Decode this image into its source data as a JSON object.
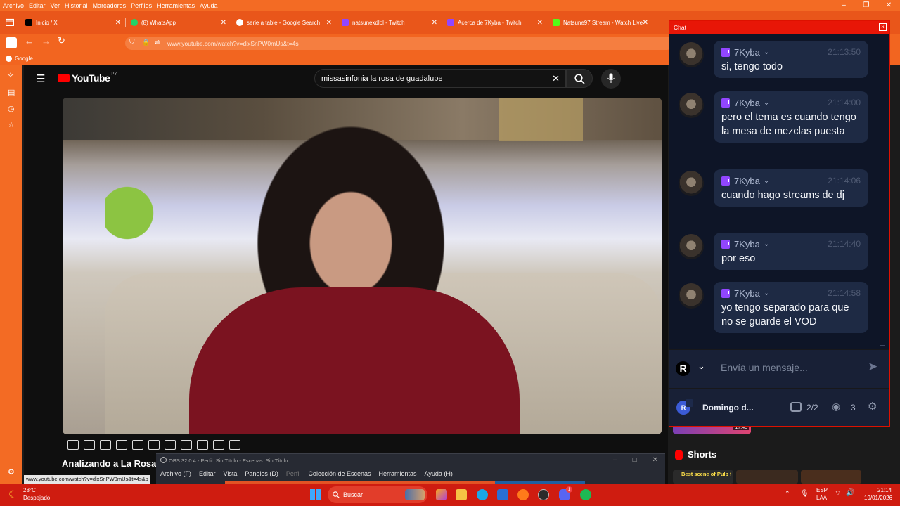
{
  "browser": {
    "menu": [
      "Archivo",
      "Editar",
      "Ver",
      "Historial",
      "Marcadores",
      "Perfiles",
      "Herramientas",
      "Ayuda"
    ],
    "tabs": [
      {
        "label": "Inicio / X",
        "color": "#000000"
      },
      {
        "label": "(8) WhatsApp",
        "color": "#25d366"
      },
      {
        "label": "serie a table - Google Search",
        "color": "#ffffff"
      },
      {
        "label": "natsunexdlol - Twitch",
        "color": "#9146ff"
      },
      {
        "label": "Acerca de 7Kyba - Twitch",
        "color": "#9146ff"
      },
      {
        "label": "Natsune97 Stream - Watch Live",
        "color": "#53fc18"
      }
    ],
    "url": "www.youtube.com/watch?v=dixSnPW0mUs&t=4s",
    "bookmark": "Google"
  },
  "youtube": {
    "logo_text": "YouTube",
    "region": "PY",
    "search_value": "missasinfonia la rosa de guadalupe",
    "video_title": "Analizando a La Rosa d",
    "status_url": "www.youtube.com/watch?v=dixSnPW0mUs&t=4s&p",
    "shorts_label": "Shorts",
    "short_caption": "Best scene of Pulp fiction",
    "thumb_duration": "17:45"
  },
  "obs": {
    "title": "OBS 32.0.4 - Perfil: Sin Título - Escenas: Sin Título",
    "menu": [
      "Archivo (F)",
      "Editar",
      "Vista",
      "Paneles (D)",
      "Perfil",
      "Colección de Escenas",
      "Herramientas",
      "Ayuda (H)"
    ]
  },
  "chat": {
    "title": "Chat",
    "messages": [
      {
        "user": "7Kyba",
        "time": "21:13:50",
        "text": "si, tengo todo"
      },
      {
        "user": "7Kyba",
        "time": "21:14:00",
        "text": "pero el tema es cuando tengo la mesa de mezclas puesta"
      },
      {
        "user": "7Kyba",
        "time": "21:14:06",
        "text": "cuando hago streams de dj"
      },
      {
        "user": "7Kyba",
        "time": "21:14:40",
        "text": "por eso"
      },
      {
        "user": "7Kyba",
        "time": "21:14:58",
        "text": "yo tengo separado para que no se guarde el VOD"
      }
    ],
    "input_placeholder": "Envía un mensaje...",
    "account_initial": "R",
    "channel": "Domingo d...",
    "stream_count": "2/2",
    "viewers": "3"
  },
  "taskbar": {
    "weather_temp": "28°C",
    "weather_desc": "Despejado",
    "search_label": "Buscar",
    "lang1": "ESP",
    "lang2": "LAA",
    "time": "21:14",
    "date": "19/01/2026",
    "discord_badge": "1"
  }
}
